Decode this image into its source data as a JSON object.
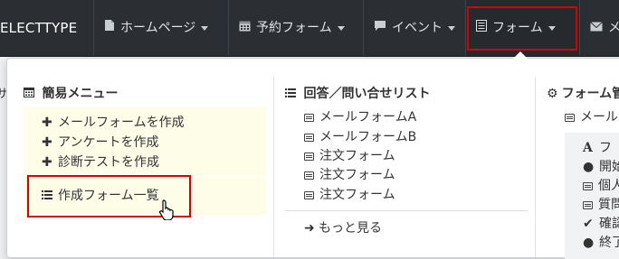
{
  "navbar": {
    "brand": "ELECTTYPE",
    "items": [
      {
        "label": "ホームページ",
        "icon": "file-icon"
      },
      {
        "label": "予約フォーム",
        "icon": "calendar-icon"
      },
      {
        "label": "イベント",
        "icon": "comment-icon"
      },
      {
        "label": "フォーム",
        "icon": "list-alt-icon"
      },
      {
        "label": "メー",
        "icon": "envelope-icon"
      }
    ]
  },
  "dropdown": {
    "simple_menu": {
      "title": "簡易メニュー",
      "items": [
        "メールフォームを作成",
        "アンケートを作成",
        "診断テストを作成"
      ],
      "list_item": "作成フォーム一覧"
    },
    "answers": {
      "title": "回答／問い合せリスト",
      "items": [
        "メールフォームA",
        "メールフォームB",
        "注文フォーム",
        "注文フォーム",
        "注文フォーム"
      ],
      "more": "もっと見る"
    },
    "settings": {
      "title": "フォーム管",
      "item": "メール",
      "sub_items": [
        "フ",
        "開始",
        "個人",
        "質問",
        "確認",
        "終了"
      ]
    }
  },
  "left_edge_char": "サ",
  "highlight_color": "#d60000"
}
